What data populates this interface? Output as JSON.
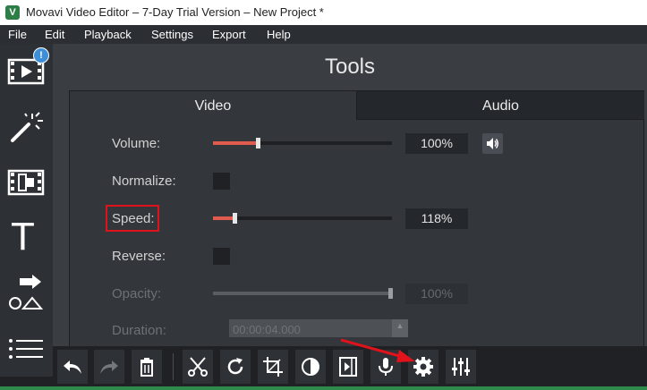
{
  "window": {
    "title": "Movavi Video Editor – 7-Day Trial Version – New Project *",
    "logo_glyph": "V"
  },
  "menu": {
    "items": [
      "File",
      "Edit",
      "Playback",
      "Settings",
      "Export",
      "Help"
    ]
  },
  "sidebar": {
    "badge": "!",
    "buttons": [
      "import-media-icon",
      "magic-wand-icon",
      "transition-film-icon",
      "titles-text-icon",
      "shapes-callouts-icon",
      "more-list-icon"
    ],
    "title_glyph": "T"
  },
  "tools": {
    "title": "Tools",
    "tabs": {
      "video": "Video",
      "audio": "Audio"
    },
    "volume": {
      "label": "Volume:",
      "value": "100%",
      "level": 0.25
    },
    "normalize": {
      "label": "Normalize:",
      "checked": false
    },
    "speed": {
      "label": "Speed:",
      "value": "118%",
      "level": 0.12
    },
    "reverse": {
      "label": "Reverse:",
      "checked": false
    },
    "opacity": {
      "label": "Opacity:",
      "value": "100%",
      "level": 1.0,
      "disabled": true
    },
    "duration": {
      "label": "Duration:",
      "value": "00:00:04.000",
      "disabled": true
    }
  },
  "toolbar": {
    "buttons": [
      "undo-icon",
      "redo-icon",
      "delete-icon",
      "cut-icon",
      "rotate-icon",
      "crop-icon",
      "color-adjust-icon",
      "split-clip-icon",
      "record-voice-icon",
      "clip-properties-gear-icon",
      "audio-equalizer-icon"
    ]
  },
  "colors": {
    "accent": "#e05a4e",
    "annotation_red": "#e0121b",
    "panel": "#33363b",
    "sidebar": "#1f2124",
    "badge": "#3e8fd8"
  }
}
